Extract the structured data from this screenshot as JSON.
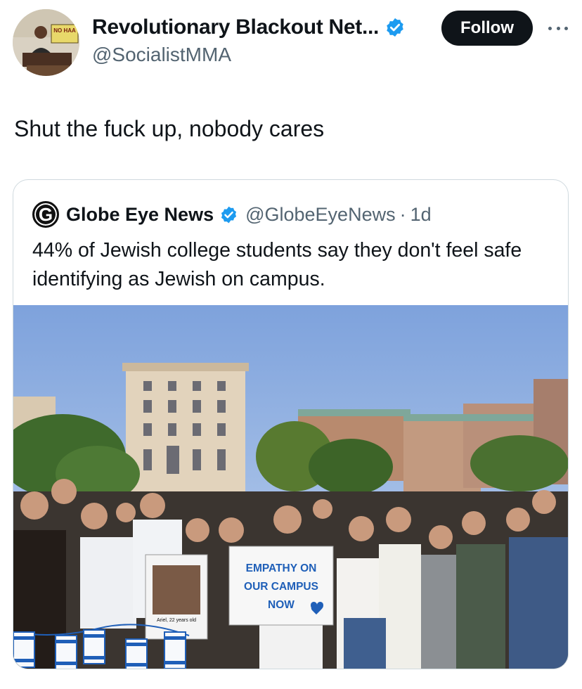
{
  "author": {
    "name": "Revolutionary Blackout Net...",
    "handle": "@SocialistMMA",
    "avatar_sign_text": "NO HAA",
    "verified_color": "#1d9bf0"
  },
  "follow_label": "Follow",
  "tweet_text": "Shut the fuck up, nobody cares",
  "quote": {
    "logo_letter": "G",
    "name": "Globe Eye News",
    "handle": "@GlobeEyeNews",
    "separator": "·",
    "time": "1d",
    "text": "44% of Jewish college students say they don't feel safe identifying as Jewish on campus.",
    "image": {
      "sign_line1": "EMPATHY ON",
      "sign_line2": "OUR CAMPUS",
      "sign_line3": "NOW",
      "poster_caption": "Ariel, 22 years old",
      "sky_color": "#8fb0e0",
      "accent_color": "#1f5fb8"
    }
  }
}
